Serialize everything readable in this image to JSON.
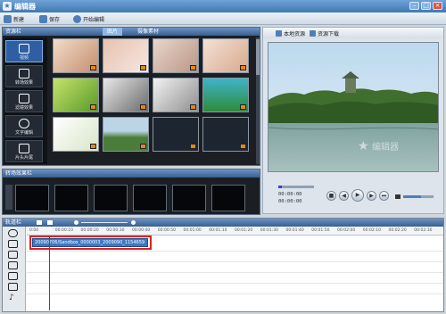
{
  "app": {
    "title": "编辑器"
  },
  "toolbar": {
    "items": [
      "新建",
      "保存",
      "开始编辑"
    ]
  },
  "library": {
    "header": "资源栏",
    "tabs": [
      "",
      "图片",
      "摄像素材"
    ]
  },
  "side_items": [
    "视频",
    "转场效果",
    "滤镜效果",
    "文字编辑",
    "片头片尾"
  ],
  "thumbs_count_note": "",
  "preview": {
    "btn_local": "本地资源",
    "btn_download": "资源下载",
    "time_current": "00:00:00",
    "time_total": "00:00:00",
    "watermark": "编辑器"
  },
  "transitions": {
    "header": "转场效果栏"
  },
  "timeline": {
    "header": "轨道栏",
    "ticks": [
      "0:00",
      "00:00:10",
      "00:00:20",
      "00:00:30",
      "00:00:40",
      "00:00:50",
      "00:01:00",
      "00:01:10",
      "00:01:20",
      "00:01:30",
      "00:01:40",
      "00:01:50",
      "00:02:00",
      "00:02:10",
      "00:02:20",
      "00:02:30"
    ],
    "clip_label": "20090706/Sandbox_0000003_2009090_1154659"
  },
  "colors": {
    "accent": "#3f78b6",
    "highlight": "#e02020"
  }
}
